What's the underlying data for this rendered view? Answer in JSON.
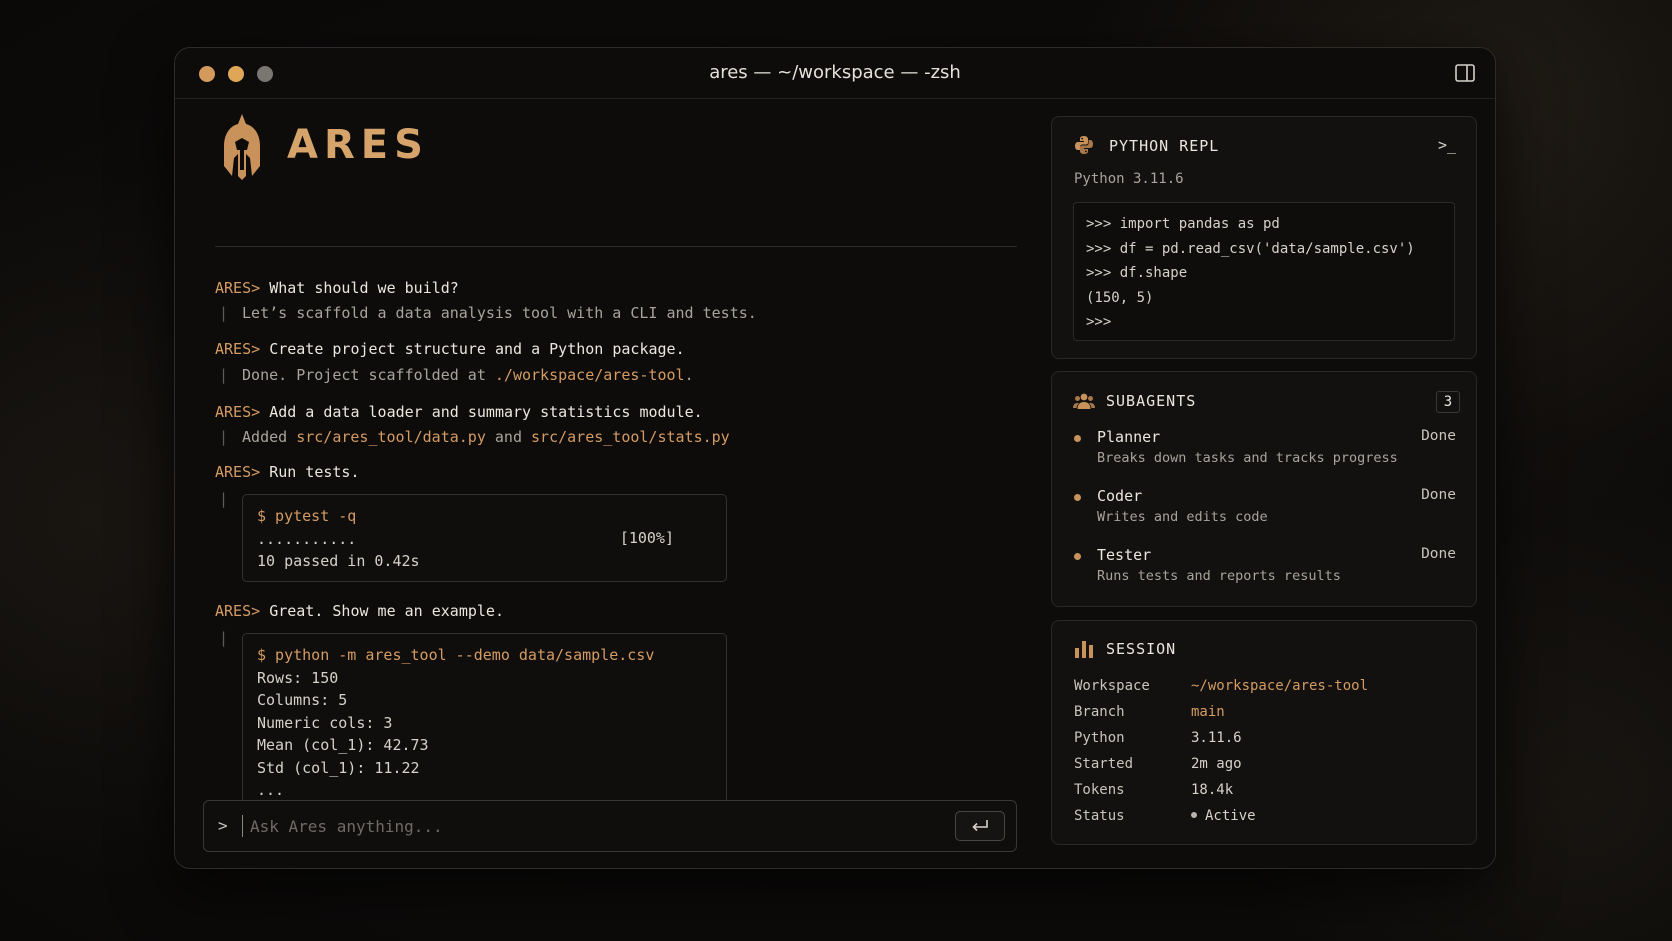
{
  "window": {
    "title": "ares — ~/workspace — -zsh"
  },
  "brand": {
    "name": "ARES"
  },
  "colors": {
    "accent": "#d49b62",
    "background": "#0d0c0b",
    "panel": "#121110"
  },
  "conversation": {
    "prompt_label": "ARES>",
    "messages": [
      {
        "user": "What should we build?",
        "reply": "Let’s scaffold a data analysis tool with a CLI and tests."
      },
      {
        "user": "Create project structure and a Python package.",
        "reply_prefix": "Done. Project scaffolded at ",
        "reply_path": "./workspace/ares-tool",
        "reply_suffix": "."
      },
      {
        "user": "Add a data loader and summary statistics module.",
        "reply_prefix": "Added ",
        "reply_path1": "src/ares_tool/data.py",
        "reply_mid": " and ",
        "reply_path2": "src/ares_tool/stats.py"
      },
      {
        "user": "Run tests.",
        "code_cmd": "$ pytest -q",
        "code_lines": [
          "...........",
          "10 passed in 0.42s"
        ],
        "code_pct": "[100%]"
      },
      {
        "user": "Great. Show me an example.",
        "code_cmd": "$ python -m ares_tool --demo data/sample.csv",
        "code_lines": [
          "Rows: 150",
          "Columns: 5",
          "Numeric cols: 3",
          "Mean (col_1): 42.73",
          "Std (col_1): 11.22",
          "..."
        ]
      }
    ]
  },
  "input": {
    "placeholder": "Ask Ares anything..."
  },
  "repl": {
    "title": "PYTHON REPL",
    "version": "Python 3.11.6",
    "lines": [
      ">>> import pandas as pd",
      ">>> df = pd.read_csv('data/sample.csv')",
      ">>> df.shape",
      "(150, 5)",
      ">>>"
    ],
    "terminal_glyph": ">_"
  },
  "subagents": {
    "title": "SUBAGENTS",
    "count": "3",
    "items": [
      {
        "name": "Planner",
        "desc": "Breaks down tasks and tracks progress",
        "status": "Done"
      },
      {
        "name": "Coder",
        "desc": "Writes and edits code",
        "status": "Done"
      },
      {
        "name": "Tester",
        "desc": "Runs tests and reports results",
        "status": "Done"
      }
    ]
  },
  "session": {
    "title": "SESSION",
    "rows": [
      {
        "key": "Workspace",
        "value": "~/workspace/ares-tool"
      },
      {
        "key": "Branch",
        "value": "main"
      },
      {
        "key": "Python",
        "value": "3.11.6"
      },
      {
        "key": "Started",
        "value": "2m ago"
      },
      {
        "key": "Tokens",
        "value": "18.4k"
      },
      {
        "key": "Status",
        "value": "Active"
      }
    ]
  }
}
